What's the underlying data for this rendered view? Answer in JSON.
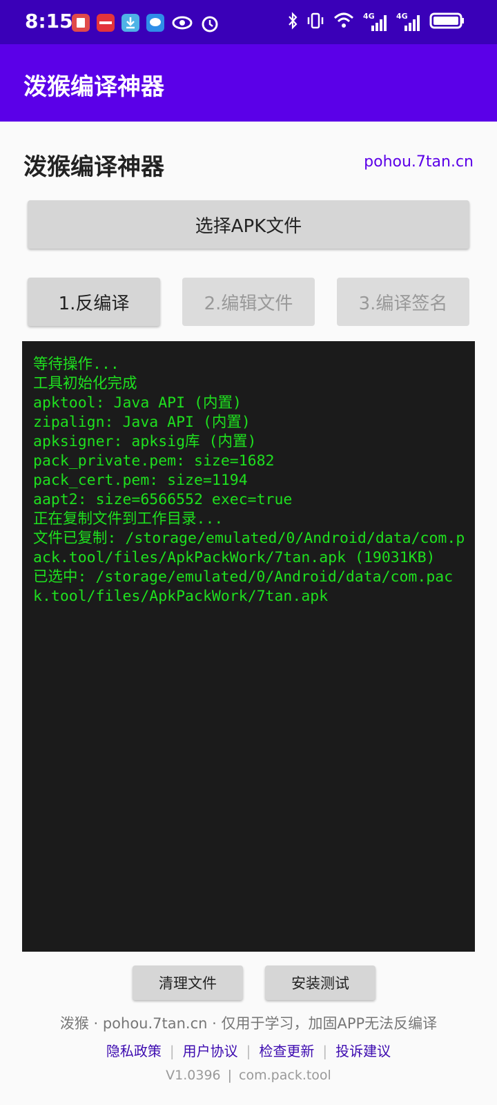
{
  "status_bar": {
    "time": "8:15",
    "notification_icons": [
      "book-app-icon",
      "huawei-app-icon",
      "download-app-icon",
      "message-app-icon",
      "eye-icon",
      "alarm-icon"
    ],
    "right_icons": [
      "bluetooth-icon",
      "vibrate-icon",
      "wifi-icon",
      "signal-4g-icon",
      "signal-4g-icon",
      "battery-icon"
    ],
    "signal_label_1": "4G",
    "signal_label_2": "4G"
  },
  "app_bar": {
    "title": "泼猴编译神器"
  },
  "header": {
    "title": "泼猴编译神器",
    "link": "pohou.7tan.cn"
  },
  "actions": {
    "select_apk": "选择APK文件",
    "step1": "1.反编译",
    "step2": "2.编辑文件",
    "step3": "3.编译签名"
  },
  "console": {
    "lines": [
      "等待操作...",
      "工具初始化完成",
      "apktool: Java API (内置)",
      "zipalign: Java API (内置)",
      "apksigner: apksig库 (内置)",
      "pack_private.pem: size=1682",
      "pack_cert.pem: size=1194",
      "aapt2: size=6566552 exec=true",
      "正在复制文件到工作目录...",
      "文件已复制: /storage/emulated/0/Android/data/com.pack.tool/files/ApkPackWork/7tan.apk (19031KB)",
      "已选中: /storage/emulated/0/Android/data/com.pack.tool/files/ApkPackWork/7tan.apk"
    ]
  },
  "bottom_buttons": {
    "clean": "清理文件",
    "install": "安装测试"
  },
  "footer": {
    "info": "泼猴 · pohou.7tan.cn · 仅用于学习，加固APP无法反编译",
    "links": [
      "隐私政策",
      "用户协议",
      "检查更新",
      "投诉建议"
    ],
    "version": "V1.0396",
    "package": "com.pack.tool",
    "divider": "|"
  },
  "colors": {
    "status_bar": "#3a00b8",
    "app_bar": "#5b00e8",
    "accent": "#5b00e8",
    "console_bg": "#1b1b1b",
    "console_text": "#1fe01f"
  }
}
